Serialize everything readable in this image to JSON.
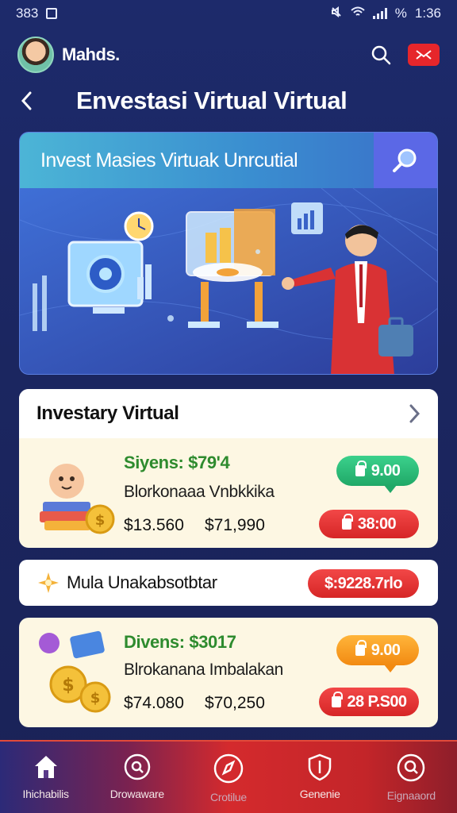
{
  "status_bar": {
    "time_left": "383",
    "time_right": "1:36",
    "battery": "%"
  },
  "header": {
    "user_name": "Mahds."
  },
  "page": {
    "title": "Envestasi Virtual Virtual"
  },
  "hero": {
    "title": "Invest Masies Virtuak Unrcutial"
  },
  "section": {
    "title": "Investary Virtual",
    "item": {
      "headline": "Siyens: $79'4",
      "description": "Blorkonaaa Vnbkkika",
      "price_a": "$13.560",
      "price_b": "$71,990",
      "pill_top": "9.00",
      "pill_bottom": "38:00"
    }
  },
  "banner": {
    "text": "Mula  Unakabsotbtar",
    "pill": "$:9228.7rlo"
  },
  "card2": {
    "headline": "Divens: $3017",
    "description": "Blrokanana Imbalakan",
    "price_a": "$74.080",
    "price_b": "$70,250",
    "pill_top": "9.00",
    "pill_bottom": "28 P.S00"
  },
  "nav": [
    {
      "label": "Ihichabilis",
      "icon": "home-icon"
    },
    {
      "label": "Drowaware",
      "icon": "search-circle-icon"
    },
    {
      "label": "Crotilue",
      "icon": "compass-icon"
    },
    {
      "label": "Genenie",
      "icon": "shield-icon"
    },
    {
      "label": "Eignaaord",
      "icon": "search-icon"
    }
  ],
  "colors": {
    "background": "#1d2a6b",
    "accent_red": "#e6262b",
    "accent_green": "#2e8b2e",
    "card": "#fdf7e3"
  }
}
